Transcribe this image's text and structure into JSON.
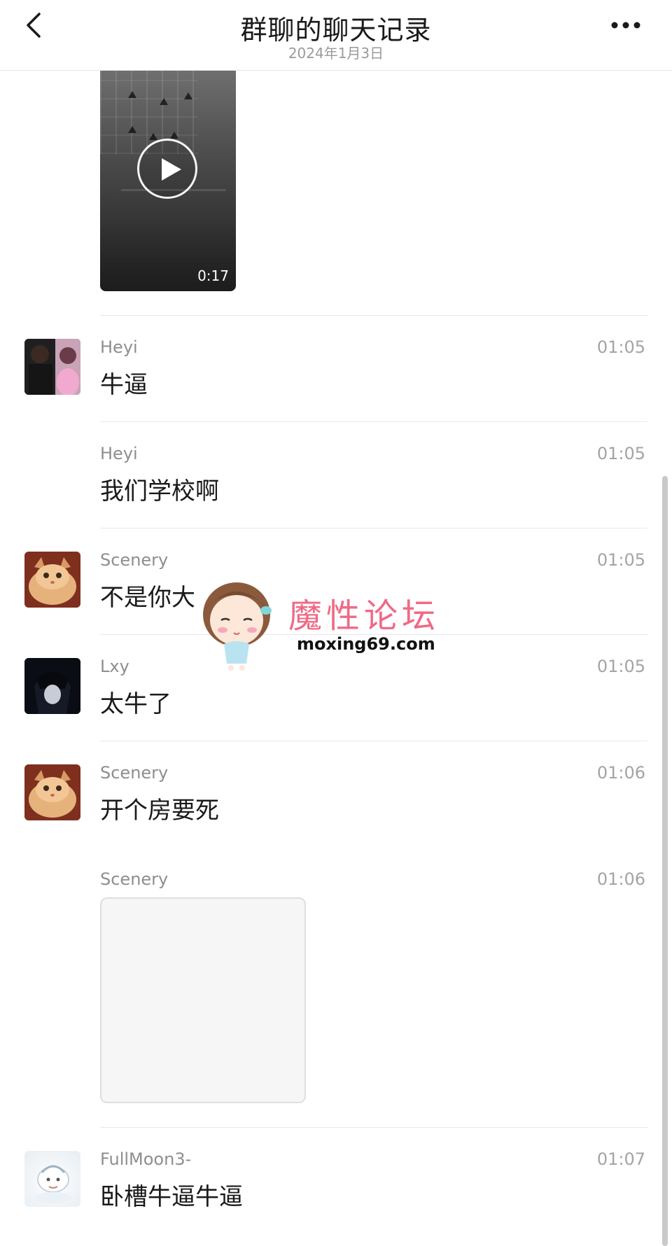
{
  "header": {
    "title": "群聊的聊天记录",
    "subtitle": "2024年1月3日",
    "back_icon": "chevron-left-icon",
    "more_icon": "more-dots-icon"
  },
  "video": {
    "duration": "0:17",
    "play_icon": "play-icon"
  },
  "messages": [
    {
      "sender": "Heyi",
      "time": "01:05",
      "text": "牛逼",
      "avatar": "avatar-heyi"
    },
    {
      "sender": "Heyi",
      "time": "01:05",
      "text": "我们学校啊"
    },
    {
      "sender": "Scenery",
      "time": "01:05",
      "text": "不是你大",
      "avatar": "avatar-cat"
    },
    {
      "sender": "Lxy",
      "time": "01:05",
      "text": "太牛了",
      "avatar": "avatar-lxy"
    },
    {
      "sender": "Scenery",
      "time": "01:06",
      "text": "开个房要死",
      "avatar": "avatar-cat"
    },
    {
      "sender": "Scenery",
      "time": "01:06",
      "type": "image"
    },
    {
      "sender": "FullMoon3-",
      "time": "01:07",
      "text": "卧槽牛逼牛逼",
      "avatar": "avatar-fullmoon"
    }
  ],
  "watermark": {
    "title": "魔性论坛",
    "url": "moxing69.com"
  }
}
